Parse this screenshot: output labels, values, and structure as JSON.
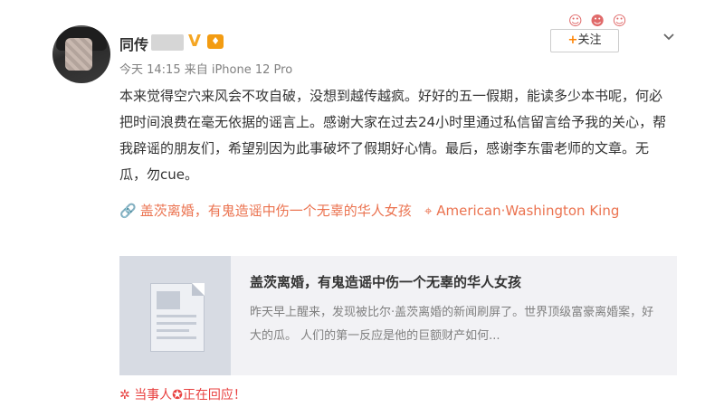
{
  "post": {
    "username": "同传",
    "verified_badge": "V",
    "time": "今天 14:15 来自 iPhone 12 Pro",
    "follow_label": "+关注",
    "follow_plus": "+",
    "follow_text": "关注",
    "content": "本来觉得空穴来风会不攻自破，没想到越传越疯。好好的五一假期，能读多少本书呢，何必把时间浪费在毫无依据的谣言上。感谢大家在过去24小时里通过私信留言给予我的关心，帮我辟谣的朋友们，希望别因为此事破坏了假期好心情。最后，感谢李东雷老师的文章。无瓜，勿cue。",
    "topic_link": "盖茨离婚，有鬼造谣中伤一个无辜的华人女孩",
    "location": "American·Washington King"
  },
  "card": {
    "title": "盖茨离婚，有鬼造谣中伤一个无辜的华人女孩",
    "description": "昨天早上醒来，发现被比尔·盖茨离婚的新闻刷屏了。世界顶级富豪离婚案，好大的瓜。 人们的第一反应是他的巨额财产如何..."
  },
  "footer": {
    "replying": "当事人✪正在回应！"
  },
  "icons": {
    "link": "link-icon",
    "location": "location-pin-icon",
    "more": "chevron-down-icon",
    "sparkle": "sparkle-icon",
    "avatar": "avatar",
    "vip": "vip-icon"
  },
  "colors": {
    "accent_orange": "#eb7350",
    "follow_plus": "#ff8200",
    "verified": "#f5a623",
    "reply_red": "#e8403f",
    "meta_gray": "#808080",
    "card_bg": "#f2f2f5"
  }
}
